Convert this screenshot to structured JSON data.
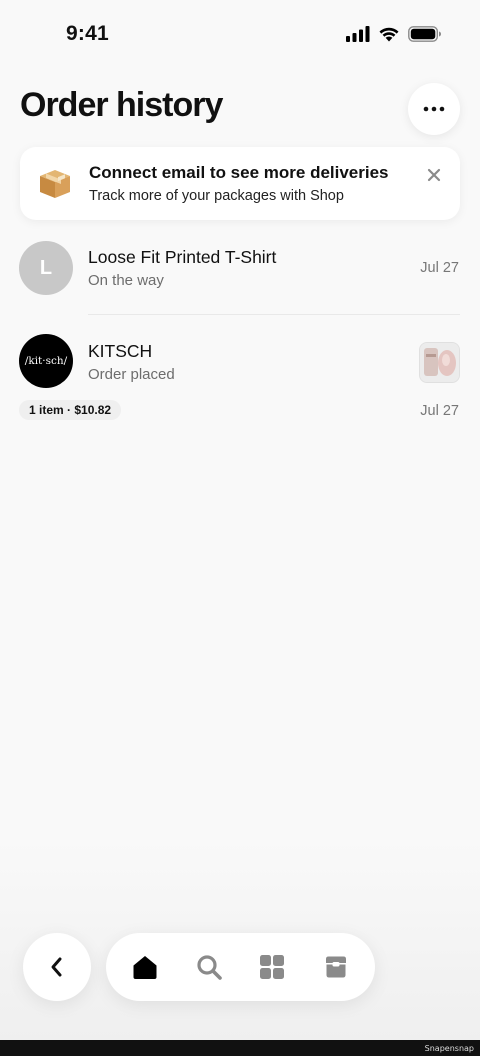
{
  "status_bar": {
    "time": "9:41"
  },
  "header": {
    "title": "Order history"
  },
  "banner": {
    "title": "Connect email to see more deliveries",
    "subtitle": "Track more of your packages with Shop"
  },
  "orders": [
    {
      "avatar_text": "L",
      "name": "Loose Fit Printed T-Shirt",
      "status": "On the way",
      "date": "Jul 27"
    },
    {
      "avatar_text": "/kit·sch/",
      "name": "KITSCH",
      "status": "Order placed",
      "date": "Jul 27",
      "summary": "1 item · $10.82"
    }
  ],
  "nav": {
    "tabs": [
      "home-icon",
      "search-icon",
      "apps-icon",
      "orders-icon"
    ],
    "active": "home-icon"
  },
  "footer": {
    "text": "Snapensnap"
  }
}
